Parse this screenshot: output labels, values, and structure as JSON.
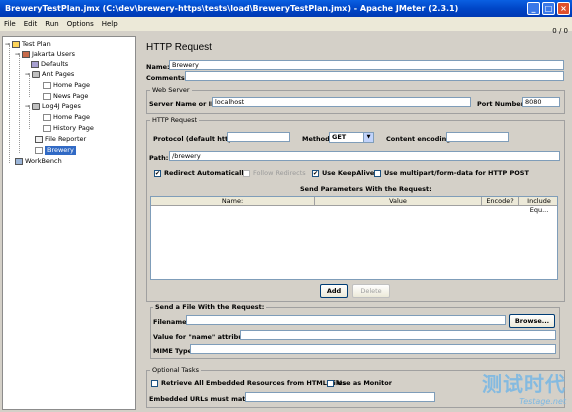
{
  "window": {
    "title": "BreweryTestPlan.jmx (C:\\dev\\brewery-https\\tests\\load\\BreweryTestPlan.jmx) - Apache JMeter (2.3.1)"
  },
  "menu": [
    "File",
    "Edit",
    "Run",
    "Options",
    "Help"
  ],
  "counter": "0 / 0",
  "tree": {
    "nodes": [
      {
        "label": "Test Plan",
        "icon": "test-plan-icon"
      },
      {
        "label": "Jakarta Users",
        "icon": "thread-group-icon"
      },
      {
        "label": "Defaults",
        "icon": "config-icon"
      },
      {
        "label": "Ant Pages",
        "icon": "controller-icon"
      },
      {
        "label": "Home Page",
        "icon": "sampler-icon"
      },
      {
        "label": "News Page",
        "icon": "sampler-icon"
      },
      {
        "label": "Log4J Pages",
        "icon": "controller-icon"
      },
      {
        "label": "Home Page",
        "icon": "sampler-icon"
      },
      {
        "label": "History Page",
        "icon": "sampler-icon"
      },
      {
        "label": "File Reporter",
        "icon": "report-icon"
      },
      {
        "label": "Brewery",
        "icon": "sampler-icon"
      },
      {
        "label": "WorkBench",
        "icon": "workbench-icon"
      }
    ],
    "selected": "Brewery"
  },
  "form": {
    "heading": "HTTP Request",
    "name_label": "Name:",
    "name_value": "Brewery",
    "comments_label": "Comments:",
    "web_server": {
      "title": "Web Server",
      "server_label": "Server Name or IP:",
      "server_value": "localhost",
      "port_label": "Port Number:",
      "port_value": "8080"
    },
    "http_request": {
      "title": "HTTP Request",
      "protocol_label": "Protocol (default http):",
      "method_label": "Method:",
      "method_value": "GET",
      "encoding_label": "Content encoding:",
      "path_label": "Path:",
      "path_value": "/brewery",
      "redirect_auto": "Redirect Automatically",
      "follow_redirects": "Follow Redirects",
      "keepalive": "Use KeepAlive",
      "multipart": "Use multipart/form-data for HTTP POST",
      "params_title": "Send Parameters With the Request:",
      "columns": [
        "Name:",
        "Value",
        "Encode?",
        "Include Equ..."
      ],
      "add_label": "Add",
      "delete_label": "Delete"
    },
    "file_section": {
      "title": "Send a File With the Request:",
      "filename_label": "Filename:",
      "browse_label": "Browse...",
      "name_attr_label": "Value for \"name\" attribute:",
      "mime_label": "MIME Type:"
    },
    "optional": {
      "title": "Optional Tasks",
      "retrieve_label": "Retrieve All Embedded Resources from HTML Files",
      "monitor_label": "Use as Monitor",
      "embedded_label": "Embedded URLs must match:"
    }
  },
  "watermark": {
    "line1": "测试时代",
    "line2": "Testage.net"
  }
}
